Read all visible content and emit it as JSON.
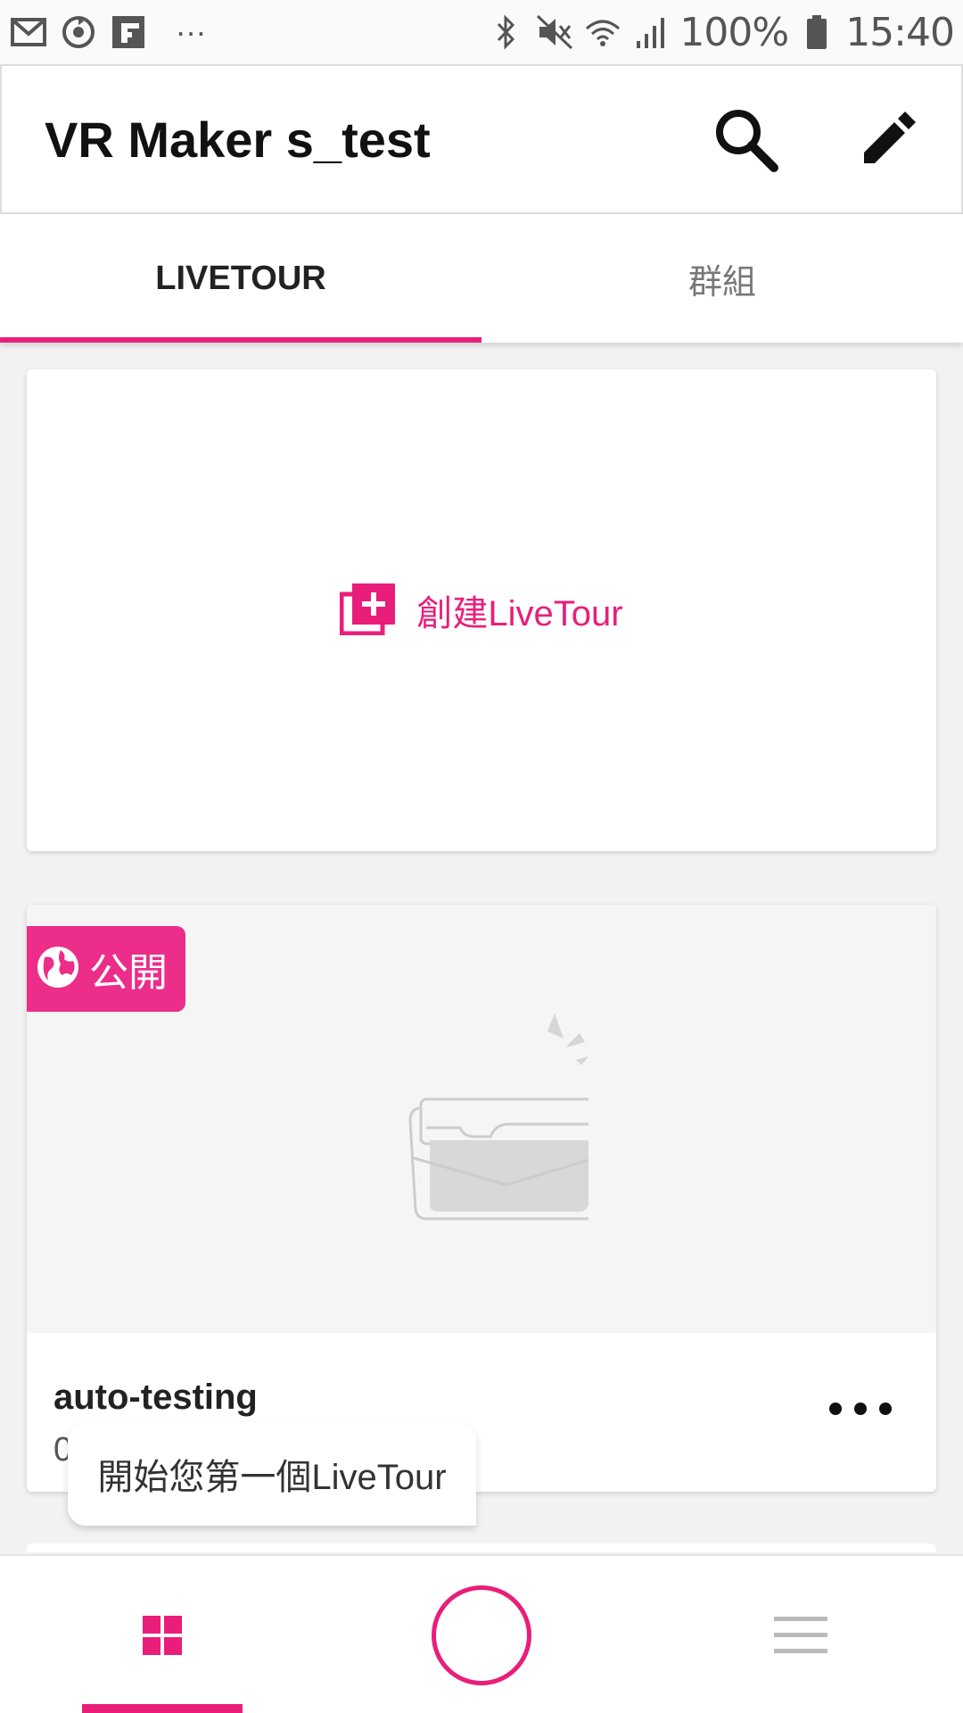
{
  "status_bar": {
    "battery": "100%",
    "time": "15:40",
    "overflow": "…",
    "icons": [
      "gmail-icon",
      "sync-icon",
      "flipboard-icon",
      "bluetooth-icon",
      "mute-icon",
      "wifi-icon",
      "signal-icon",
      "battery-icon"
    ]
  },
  "app_bar": {
    "title": "VR Maker s_test",
    "actions": [
      "search-icon",
      "edit-icon"
    ]
  },
  "tabs": [
    {
      "label": "LIVETOUR",
      "active": true
    },
    {
      "label": "群組",
      "active": false
    }
  ],
  "create_card": {
    "label": "創建LiveTour",
    "icon": "add-to-library-icon"
  },
  "tour_card": {
    "badge_label": "公開",
    "badge_icon": "globe-icon",
    "name": "auto-testing",
    "subtitle": "0",
    "menu_icon": "more-horizontal-icon"
  },
  "tooltip": {
    "text": "開始您第一個LiveTour"
  },
  "bottom_nav": {
    "items": [
      "grid-icon",
      "record-circle-icon",
      "menu-icon"
    ],
    "active": 0
  },
  "colors": {
    "accent": "#e91e7a",
    "badge": "#ec2d8a"
  }
}
